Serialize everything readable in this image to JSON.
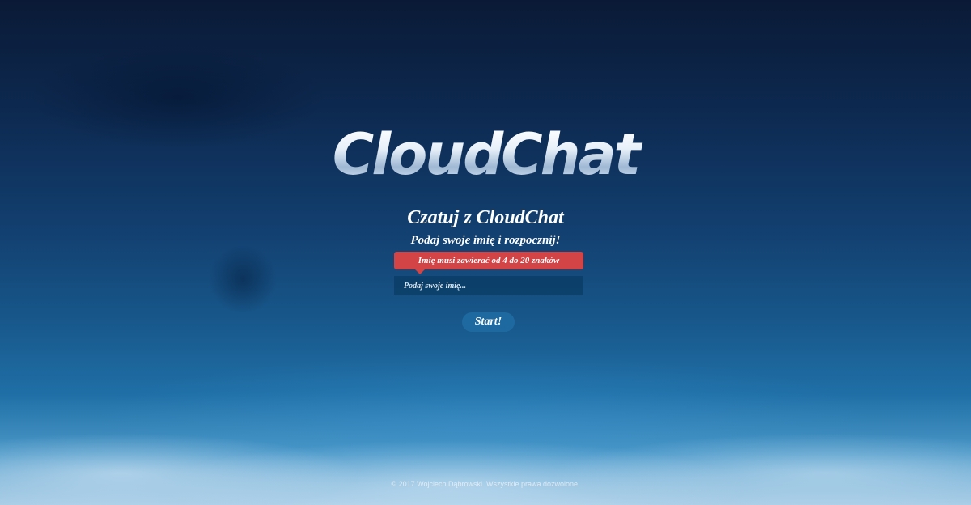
{
  "logo": {
    "text": "CloudChat"
  },
  "header": {
    "title": "Czatuj z CloudChat",
    "subtitle": "Podaj swoje imię i rozpocznij!"
  },
  "form": {
    "error_message": "Imię musi zawierać od 4 do 20 znaków",
    "name_placeholder": "Podaj swoje imię...",
    "name_value": "",
    "start_label": "Start!"
  },
  "footer": {
    "text": "© 2017 Wojciech Dąbrowski. Wszystkie prawa dozwolone."
  },
  "colors": {
    "error": "#d34447",
    "button": "#1e6aa0",
    "input_bg": "#0a3c64"
  }
}
